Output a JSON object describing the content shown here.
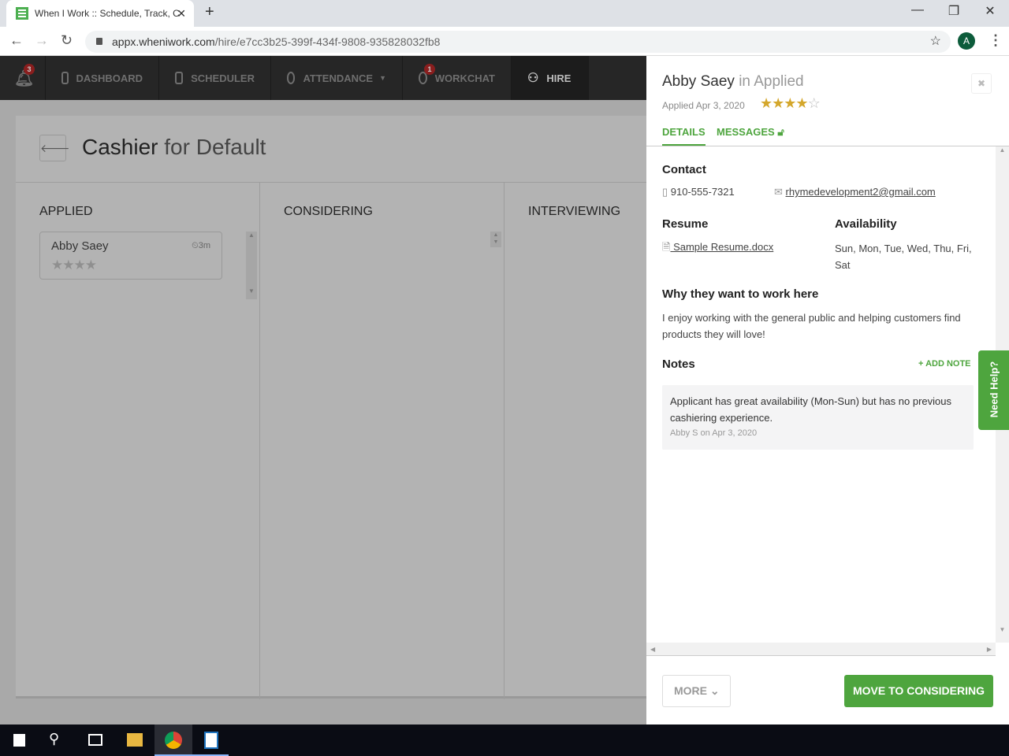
{
  "browser": {
    "tab_title": "When I Work :: Schedule, Track, C",
    "url_host": "appx.wheniwork.com",
    "url_path": "/hire/e7cc3b25-399f-434f-9808-935828032fb8",
    "avatar_letter": "A"
  },
  "nav": {
    "notifications_count": "3",
    "items": [
      {
        "label": "DASHBOARD"
      },
      {
        "label": "SCHEDULER"
      },
      {
        "label": "ATTENDANCE"
      },
      {
        "label": "WORKCHAT",
        "badge": "1"
      },
      {
        "label": "HIRE"
      }
    ]
  },
  "board": {
    "title_role": "Cashier",
    "title_rest": "for Default",
    "columns": [
      "APPLIED",
      "CONSIDERING",
      "INTERVIEWING"
    ],
    "card": {
      "name": "Abby Saey",
      "age": "3m",
      "rating": 4
    }
  },
  "panel": {
    "name": "Abby Saey",
    "stage": "in Applied",
    "applied": "Applied Apr 3, 2020",
    "rating": 4,
    "rating_max": 5,
    "tabs": [
      "DETAILS",
      "MESSAGES"
    ],
    "contact_heading": "Contact",
    "phone": "910-555-7321",
    "email": "rhymedevelopment2@gmail.com",
    "resume_heading": "Resume",
    "resume_file": " Sample Resume.docx",
    "availability_heading": "Availability",
    "availability": "Sun, Mon, Tue, Wed, Thu, Fri, Sat",
    "why_heading": "Why they want to work here",
    "why_text": "I enjoy working with the general public and helping customers find products they will love!",
    "notes_heading": "Notes",
    "add_note": "+ ADD NOTE",
    "note": {
      "text": "Applicant has great availability (Mon-Sun) but has no previous cashiering experience.",
      "meta": "Abby S on Apr 3, 2020"
    },
    "more_label": "MORE",
    "move_label": "MOVE TO CONSIDERING"
  },
  "help_label": "Need Help?",
  "colors": {
    "green": "#4ea53e",
    "star": "#d4a72c"
  }
}
